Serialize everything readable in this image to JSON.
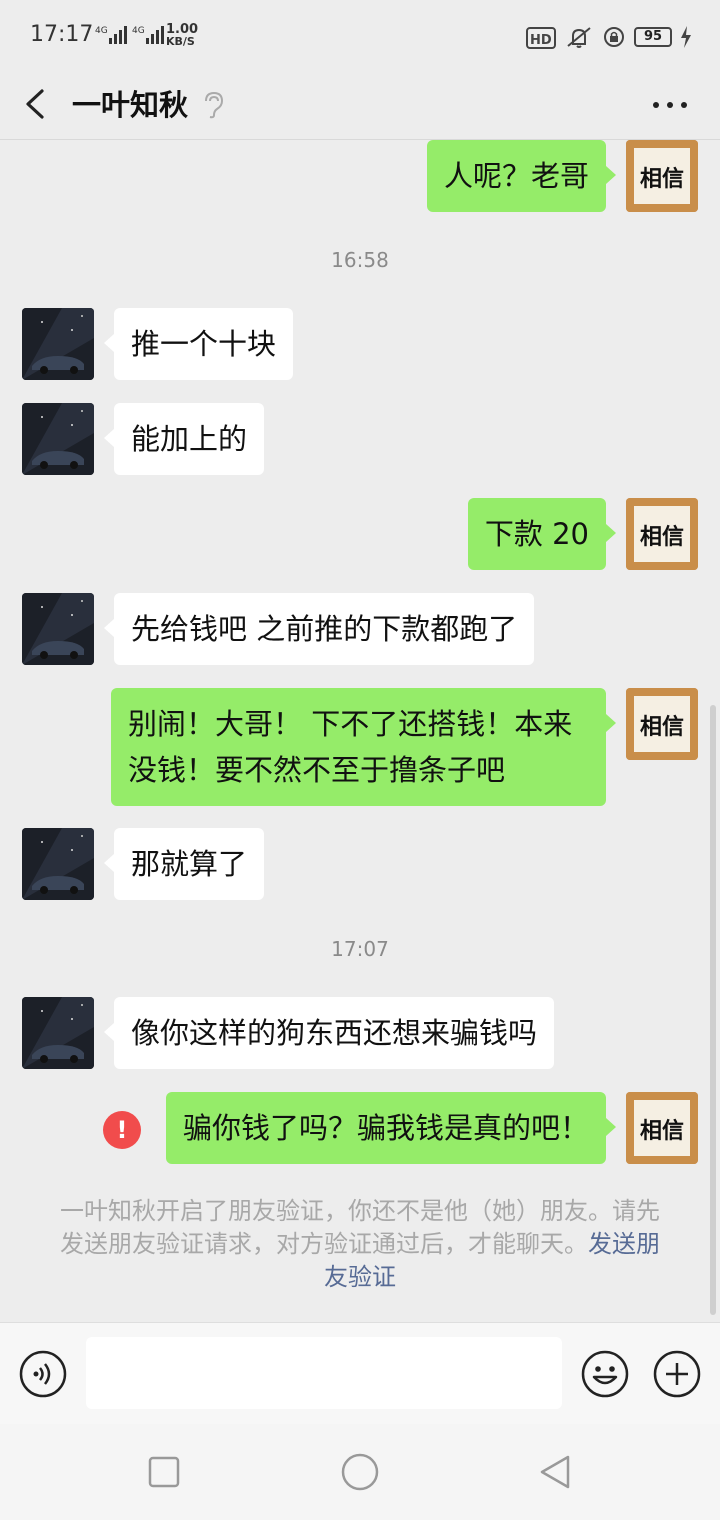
{
  "status_bar": {
    "time": "17:17",
    "net1": "4G",
    "net2": "4G",
    "speed_value": "1.00",
    "speed_unit": "KB/S",
    "hd_label": "HD",
    "battery": "95"
  },
  "header": {
    "title": "一叶知秋",
    "back_icon": "chevron-left-icon",
    "earpiece_icon": "ear-icon",
    "more_icon": "more-dots-icon"
  },
  "messages": [
    {
      "side": "right",
      "text": "人呢？老哥"
    },
    {
      "type": "timestamp",
      "text": "16:58"
    },
    {
      "side": "left",
      "text": "推一个十块"
    },
    {
      "side": "left",
      "text": "能加上的"
    },
    {
      "side": "right",
      "text": "下款 20"
    },
    {
      "side": "left",
      "text": "先给钱吧 之前推的下款都跑了"
    },
    {
      "side": "right",
      "text": "别闹！大哥！  下不了还搭钱！本来没钱！要不然不至于撸条子吧"
    },
    {
      "side": "left",
      "text": "那就算了"
    },
    {
      "type": "timestamp",
      "text": "17:07"
    },
    {
      "side": "left",
      "text": "像你这样的狗东西还想来骗钱吗"
    },
    {
      "side": "right",
      "text": "骗你钱了吗？骗我钱是真的吧！",
      "status": "failed",
      "error_mark": "!"
    }
  ],
  "system_note": {
    "text": "一叶知秋开启了朋友验证，你还不是他（她）朋友。请先发送朋友验证请求，对方验证通过后，才能聊天。",
    "link": "发送朋友验证"
  },
  "self_avatar_text": "相信",
  "input_bar": {
    "field_value": "",
    "voice_icon": "voice-icon",
    "emoji_icon": "emoji-icon",
    "plus_icon": "plus-icon"
  },
  "nav": {
    "recent_icon": "square-icon",
    "home_icon": "circle-icon",
    "back_icon": "triangle-back-icon"
  },
  "colors": {
    "sent_bubble": "#95ec69",
    "received_bubble": "#ffffff",
    "background": "#ededed",
    "link": "#576b95",
    "error": "#f14c4c"
  }
}
